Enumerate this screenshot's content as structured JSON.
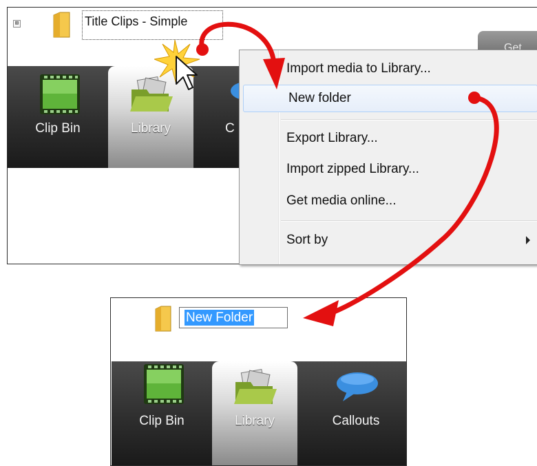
{
  "tree": {
    "expander": "⊞",
    "item_label": "Title Clips - Simple"
  },
  "top_right_button": {
    "label": "Get"
  },
  "tabs": [
    {
      "label": "Clip Bin",
      "icon": "film-clip-icon"
    },
    {
      "label": "Library",
      "icon": "library-folder-icon"
    },
    {
      "label": "C",
      "icon": "callout-bubble-icon"
    }
  ],
  "context_menu": {
    "items": [
      {
        "label": "Import media to Library..."
      },
      {
        "label": "New folder"
      },
      {
        "label": "Export Library..."
      },
      {
        "label": "Import zipped Library..."
      },
      {
        "label": "Get media online..."
      },
      {
        "label": "Sort by"
      }
    ]
  },
  "rename": {
    "value": "New Folder"
  },
  "bottom_tabs": [
    {
      "label": "Clip Bin",
      "icon": "film-clip-icon"
    },
    {
      "label": "Library",
      "icon": "library-folder-icon"
    },
    {
      "label": "Callouts",
      "icon": "callout-bubble-icon"
    }
  ],
  "colors": {
    "arrow": "#e31010",
    "selection": "#3399ff",
    "folder": "#f5c84c"
  }
}
